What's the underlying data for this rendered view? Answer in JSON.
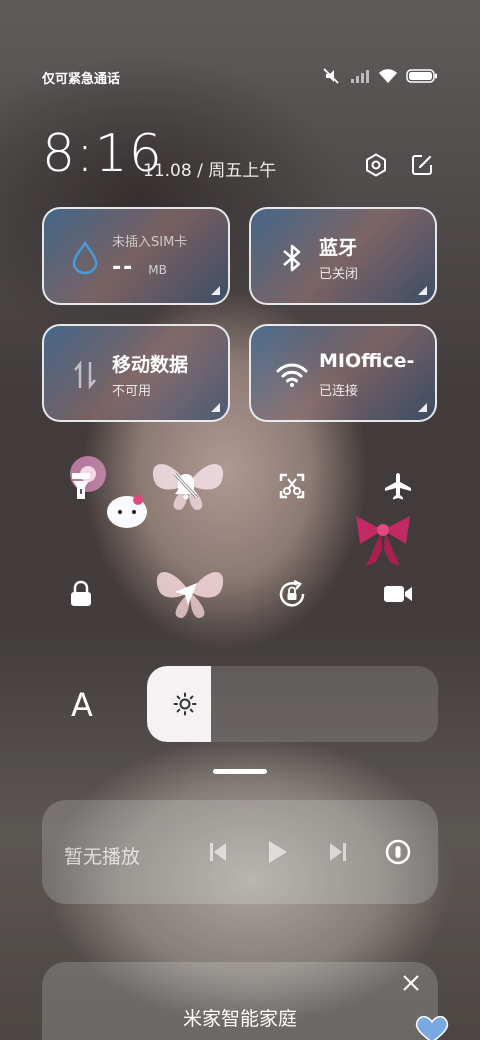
{
  "status": {
    "carrier": "仅可紧急通话",
    "icons": [
      "silent-icon",
      "signal-icon",
      "wifi-icon",
      "battery-icon"
    ]
  },
  "header": {
    "time": "8:16",
    "date": "11.08 / 周五上午",
    "settings_icon": "gear-icon",
    "edit_icon": "edit-icon"
  },
  "tiles": {
    "sim": {
      "label": "未插入SIM卡",
      "value": "--",
      "unit": "MB",
      "icon": "water-drop-icon"
    },
    "bluetooth": {
      "label": "蓝牙",
      "status": "已关闭",
      "icon": "bluetooth-icon"
    },
    "mobile_data": {
      "label": "移动数据",
      "status": "不可用",
      "icon": "mobile-data-icon"
    },
    "wifi": {
      "label": "MIOffice-",
      "status": "已连接",
      "icon": "wifi-icon"
    }
  },
  "toggles": {
    "row1": [
      "flashlight-icon",
      "bell-off-icon",
      "screenshot-icon",
      "airplane-icon"
    ],
    "row2": [
      "lock-icon",
      "location-icon",
      "rotation-lock-icon",
      "video-icon"
    ]
  },
  "brightness": {
    "font_button": "A",
    "level": 0.22,
    "icon": "sun-icon"
  },
  "media": {
    "label": "暂无播放",
    "controls": [
      "previous-icon",
      "play-icon",
      "next-icon",
      "cast-icon"
    ]
  },
  "card": {
    "title": "米家智能家庭"
  },
  "colors": {
    "accent": "#4a9ad8",
    "tile_border": "#ffffff"
  }
}
